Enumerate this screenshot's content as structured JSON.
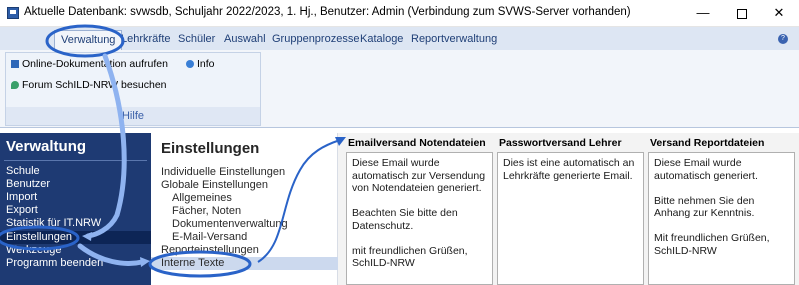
{
  "window": {
    "title": "Aktuelle Datenbank: svwsdb, Schuljahr 2022/2023, 1. Hj., Benutzer: Admin (Verbindung zum SVWS-Server vorhanden)",
    "minimize": "—",
    "close": "✕"
  },
  "ribbon": {
    "tabs": [
      "Verwaltung",
      "Lehrkräfte",
      "Schüler",
      "Auswahl",
      "Gruppenprozesse",
      "Kataloge",
      "Reportverwaltung"
    ],
    "active_tab": "Verwaltung",
    "help_icon": "?",
    "group": {
      "label": "Hilfe",
      "items": [
        {
          "label": "Online-Dokumentation aufrufen",
          "icon": "book-icon"
        },
        {
          "label": "Info",
          "icon": "info-icon"
        },
        {
          "label": "Forum SchILD-NRW besuchen",
          "icon": "forum-icon"
        }
      ]
    }
  },
  "nav": {
    "title": "Verwaltung",
    "items": [
      "Schule",
      "Benutzer",
      "Import",
      "Export",
      "Statistik für IT.NRW",
      "Einstellungen",
      "Werkzeuge",
      "Programm beenden"
    ],
    "selected": "Einstellungen"
  },
  "settings": {
    "title": "Einstellungen",
    "items": [
      {
        "label": "Individuelle Einstellungen",
        "level": 0
      },
      {
        "label": "Globale Einstellungen",
        "level": 0
      },
      {
        "label": "Allgemeines",
        "level": 1
      },
      {
        "label": "Fächer, Noten",
        "level": 1
      },
      {
        "label": "Dokumentenverwaltung",
        "level": 1
      },
      {
        "label": "E-Mail-Versand",
        "level": 1
      },
      {
        "label": "Reporteinstellungen",
        "level": 0
      },
      {
        "label": "Interne Texte",
        "level": 0
      }
    ],
    "selected": "Interne Texte"
  },
  "columns": [
    {
      "header": "Emailversand Notendateien",
      "text": "Diese Email wurde automatisch zur Versendung von Notendateien generiert.\n\nBeachten Sie bitte den Datenschutz.\n\nmit freundlichen Grüßen,\nSchILD-NRW"
    },
    {
      "header": "Passwortversand Lehrer",
      "text": "Dies ist eine automatisch an Lehrkräfte generierte Email."
    },
    {
      "header": "Versand Reportdateien",
      "text": "Diese Email wurde automatisch generiert.\n\nBitte nehmen Sie den Anhang zur Kenntnis.\n\nMit freundlichen Grüßen,\nSchILD-NRW"
    }
  ],
  "colors": {
    "nav_background": "#1e3a73",
    "nav_selected": "#0d2556",
    "ribbon_background": "#dde6f3",
    "annotation_stroke": "#2a63c8",
    "annotation_fill": "#8fb3f0"
  }
}
